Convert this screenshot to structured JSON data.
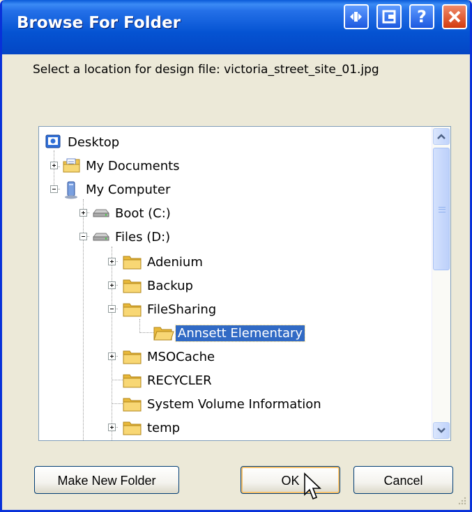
{
  "window": {
    "title": "Browse For Folder"
  },
  "prompt": "Select a location for design file: victoria_street_site_01.jpg",
  "tree": {
    "desktop": "Desktop",
    "my_documents": "My Documents",
    "my_computer": "My Computer",
    "boot": "Boot (C:)",
    "files": "Files (D:)",
    "adenium": "Adenium",
    "backup": "Backup",
    "filesharing": "FileSharing",
    "annsett": "Annsett Elementary",
    "msocache": "MSOCache",
    "recycler": "RECYCLER",
    "svi": "System Volume Information",
    "temp": "temp"
  },
  "buttons": {
    "make_new_folder": "Make New Folder",
    "ok": "OK",
    "cancel": "Cancel"
  },
  "colors": {
    "titlebar": "#0553d2",
    "selection": "#316ac5",
    "dialog_bg": "#ece9d8"
  }
}
